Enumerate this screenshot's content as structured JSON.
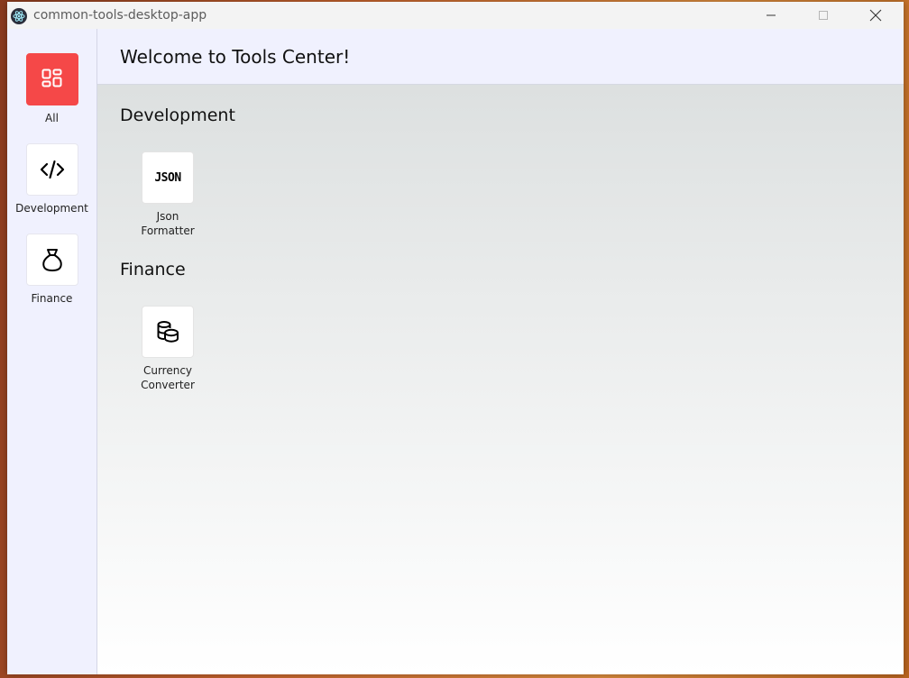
{
  "window": {
    "title": "common-tools-desktop-app"
  },
  "sidebar": {
    "items": [
      {
        "label": "All",
        "icon": "dashboard-icon",
        "active": true
      },
      {
        "label": "Development",
        "icon": "code-icon",
        "active": false
      },
      {
        "label": "Finance",
        "icon": "money-bag-icon",
        "active": false
      }
    ]
  },
  "header": {
    "title": "Welcome to Tools Center!"
  },
  "sections": [
    {
      "title": "Development",
      "tools": [
        {
          "label_line1": "Json",
          "label_line2": "Formatter",
          "icon_text": "JSON",
          "icon": "json-icon"
        }
      ]
    },
    {
      "title": "Finance",
      "tools": [
        {
          "label_line1": "Currency",
          "label_line2": "Converter",
          "icon": "coins-icon"
        }
      ]
    }
  ],
  "colors": {
    "accent": "#f54848",
    "sidebar_bg": "#f0f1fe"
  }
}
